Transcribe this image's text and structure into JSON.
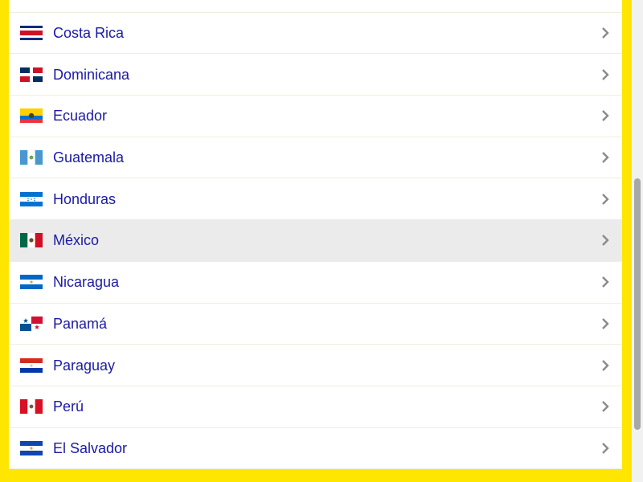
{
  "countries": [
    {
      "name": "",
      "flag": "partial-flag-icon",
      "highlighted": false
    },
    {
      "name": "Costa Rica",
      "flag": "costa-rica-flag-icon",
      "highlighted": false
    },
    {
      "name": "Dominicana",
      "flag": "dominican-republic-flag-icon",
      "highlighted": false
    },
    {
      "name": "Ecuador",
      "flag": "ecuador-flag-icon",
      "highlighted": false
    },
    {
      "name": "Guatemala",
      "flag": "guatemala-flag-icon",
      "highlighted": false
    },
    {
      "name": "Honduras",
      "flag": "honduras-flag-icon",
      "highlighted": false
    },
    {
      "name": "México",
      "flag": "mexico-flag-icon",
      "highlighted": true
    },
    {
      "name": "Nicaragua",
      "flag": "nicaragua-flag-icon",
      "highlighted": false
    },
    {
      "name": "Panamá",
      "flag": "panama-flag-icon",
      "highlighted": false
    },
    {
      "name": "Paraguay",
      "flag": "paraguay-flag-icon",
      "highlighted": false
    },
    {
      "name": "Perú",
      "flag": "peru-flag-icon",
      "highlighted": false
    },
    {
      "name": "El Salvador",
      "flag": "el-salvador-flag-icon",
      "highlighted": false
    }
  ],
  "colors": {
    "frame": "#ffe600",
    "link_text": "#1a1aa6",
    "highlight_row": "#ebebeb",
    "chevron": "#8a8a8a"
  },
  "icons": {
    "row_chevron": "chevron-right-icon"
  }
}
